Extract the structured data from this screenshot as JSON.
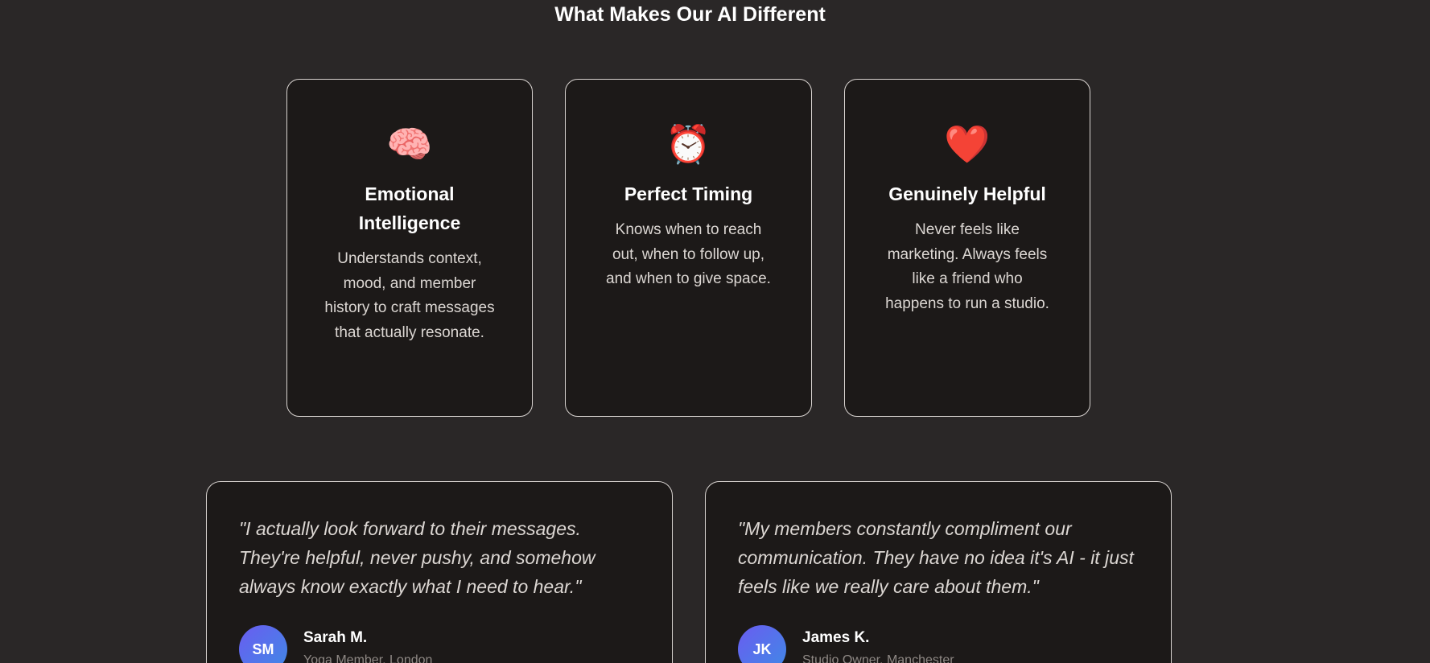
{
  "section": {
    "title": "What Makes Our AI Different"
  },
  "features": [
    {
      "icon": "brain-icon",
      "glyph": "🧠",
      "title": "Emotional Intelligence",
      "description": "Understands context, mood, and member history to craft messages that actually resonate."
    },
    {
      "icon": "alarm-clock-icon",
      "glyph": "⏰",
      "title": "Perfect Timing",
      "description": "Knows when to reach out, when to follow up, and when to give space."
    },
    {
      "icon": "heart-icon",
      "glyph": "❤️",
      "title": "Genuinely Helpful",
      "description": "Never feels like marketing. Always feels like a friend who happens to run a studio."
    }
  ],
  "testimonials": [
    {
      "quote": "\"I actually look forward to their messages. They're helpful, never pushy, and somehow always know exactly what I need to hear.\"",
      "initials": "SM",
      "name": "Sarah M.",
      "role": "Yoga Member, London"
    },
    {
      "quote": "\"My members constantly compliment our communication. They have no idea it's AI - it just feels like we really care about them.\"",
      "initials": "JK",
      "name": "James K.",
      "role": "Studio Owner, Manchester"
    }
  ],
  "colors": {
    "background": "#2a2727",
    "card": "#1c1918",
    "border": "#d8d3d0",
    "avatar_gradient_start": "#6a5cf0",
    "avatar_gradient_end": "#3f8ae6"
  }
}
